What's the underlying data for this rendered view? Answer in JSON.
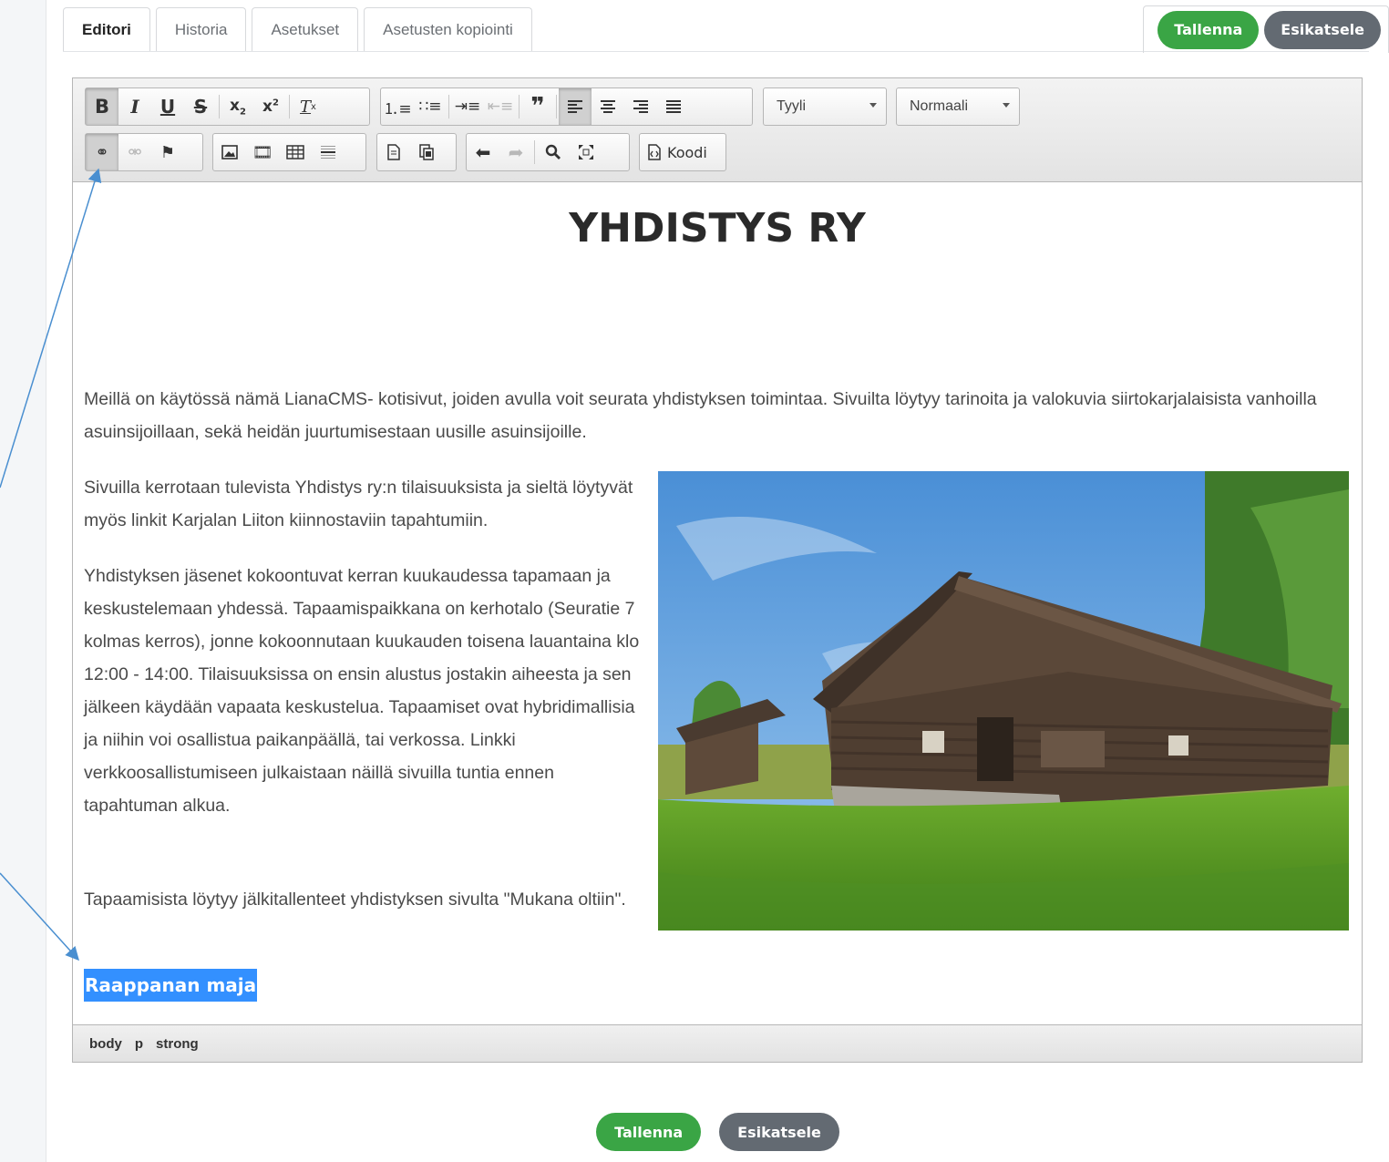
{
  "tabs": [
    "Editori",
    "Historia",
    "Asetukset",
    "Asetusten kopiointi"
  ],
  "actions": {
    "save": "Tallenna",
    "preview": "Esikatsele"
  },
  "toolbar": {
    "style_combo": "Tyyli",
    "format_combo": "Normaali",
    "code_label": "Koodi"
  },
  "content": {
    "title": "YHDISTYS RY",
    "intro": "Meillä on käytössä nämä LianaCMS- kotisivut, joiden avulla voit seurata yhdistyksen toimintaa. Sivuilta löytyy tarinoita ja valokuvia siirtokarjalaisista vanhoilla asuinsijoillaan, sekä heidän juurtumisestaan uusille asuinsijoille.",
    "p1": "Sivuilla kerrotaan tulevista Yhdistys ry:n tilaisuuksista ja sieltä löytyvät myös linkit Karjalan Liiton kiinnostaviin tapahtumiin.",
    "p2": "Yhdistyksen jäsenet kokoontuvat kerran kuukaudessa tapamaan ja keskustelemaan yhdessä. Tapaamispaikkana on kerhotalo (Seuratie 7 kolmas kerros), jonne kokoonnutaan kuukauden toisena lauantaina klo 12:00 - 14:00. Tilaisuuksissa on ensin alustus jostakin aiheesta ja sen jälkeen käydään vapaata keskustelua. Tapaamiset ovat hybridimallisia ja niihin voi osallistua paikanpäällä, tai verkossa. Linkki verkkoosallistumiseen julkaistaan näillä sivuilla tuntia ennen tapahtuman alkua.",
    "p3": "Tapaamisista löytyy jälkitallenteet yhdistyksen sivulta \"Mukana oltiin\".",
    "selected": "Raappanan maja"
  },
  "statusbar": [
    "body",
    "p",
    "strong"
  ]
}
